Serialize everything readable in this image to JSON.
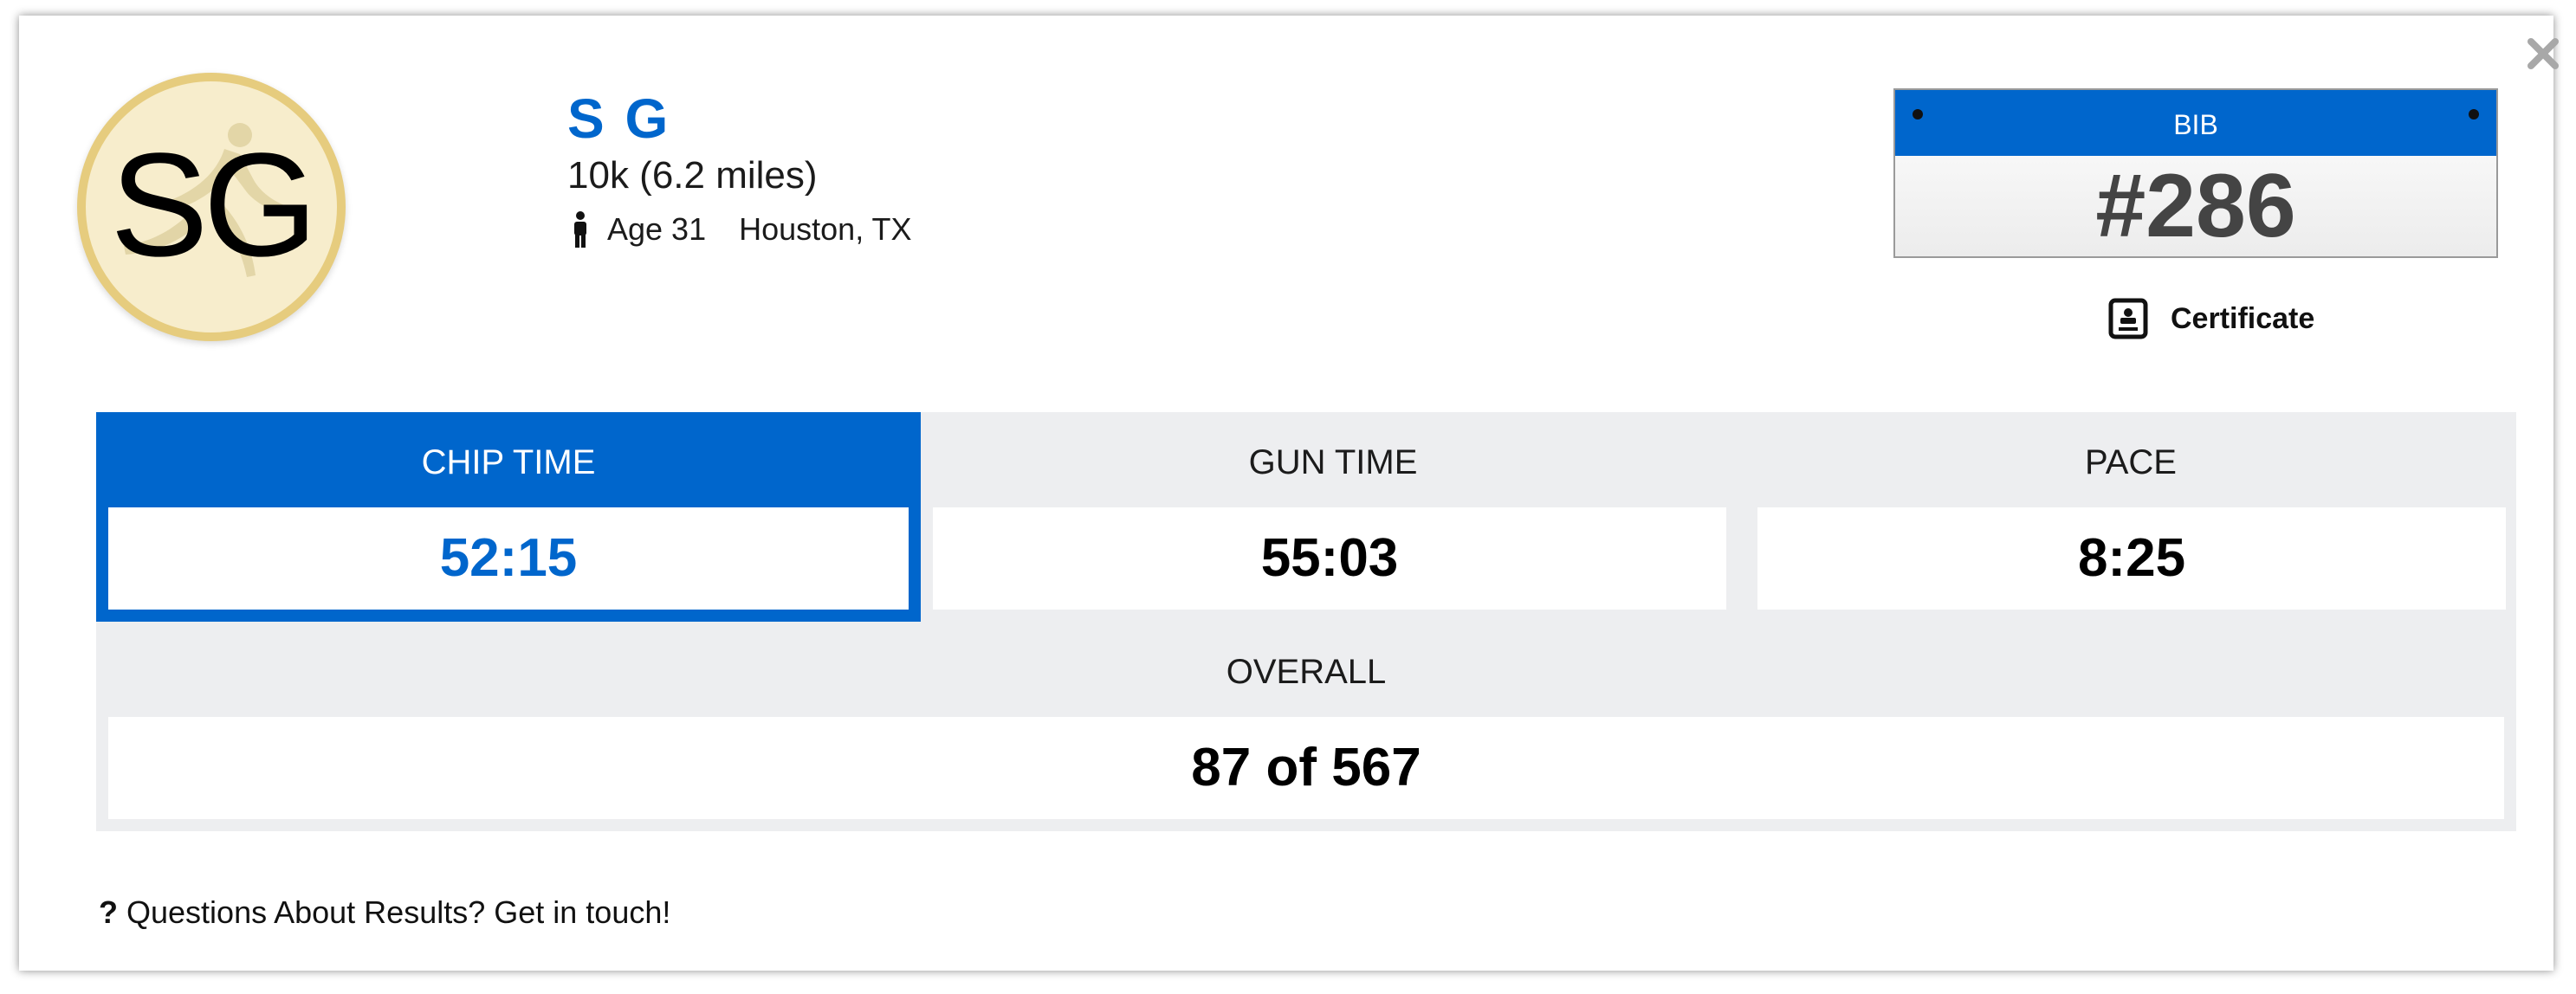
{
  "participant": {
    "initials": "SG",
    "name": "S G",
    "race": "10k (6.2 miles)",
    "age": "Age 31",
    "location": "Houston, TX"
  },
  "bib": {
    "label": "BIB",
    "number": "#286"
  },
  "certificate": {
    "label": "Certificate"
  },
  "stats": {
    "chip_time": {
      "label": "CHIP TIME",
      "value": "52:15"
    },
    "gun_time": {
      "label": "GUN TIME",
      "value": "55:03"
    },
    "pace": {
      "label": "PACE",
      "value": "8:25"
    },
    "overall": {
      "label": "OVERALL",
      "value": "87 of 567"
    }
  },
  "footer": {
    "question_mark": "?",
    "questions_link": "Questions About Results? Get in touch!"
  },
  "colors": {
    "accent": "#0066cc",
    "stats_bg": "#edeef0",
    "avatar_bg": "#f7edcc",
    "avatar_border": "#e6cc7e"
  },
  "icons": [
    "close-icon",
    "person-icon",
    "certificate-icon",
    "runner-silhouette-icon"
  ]
}
